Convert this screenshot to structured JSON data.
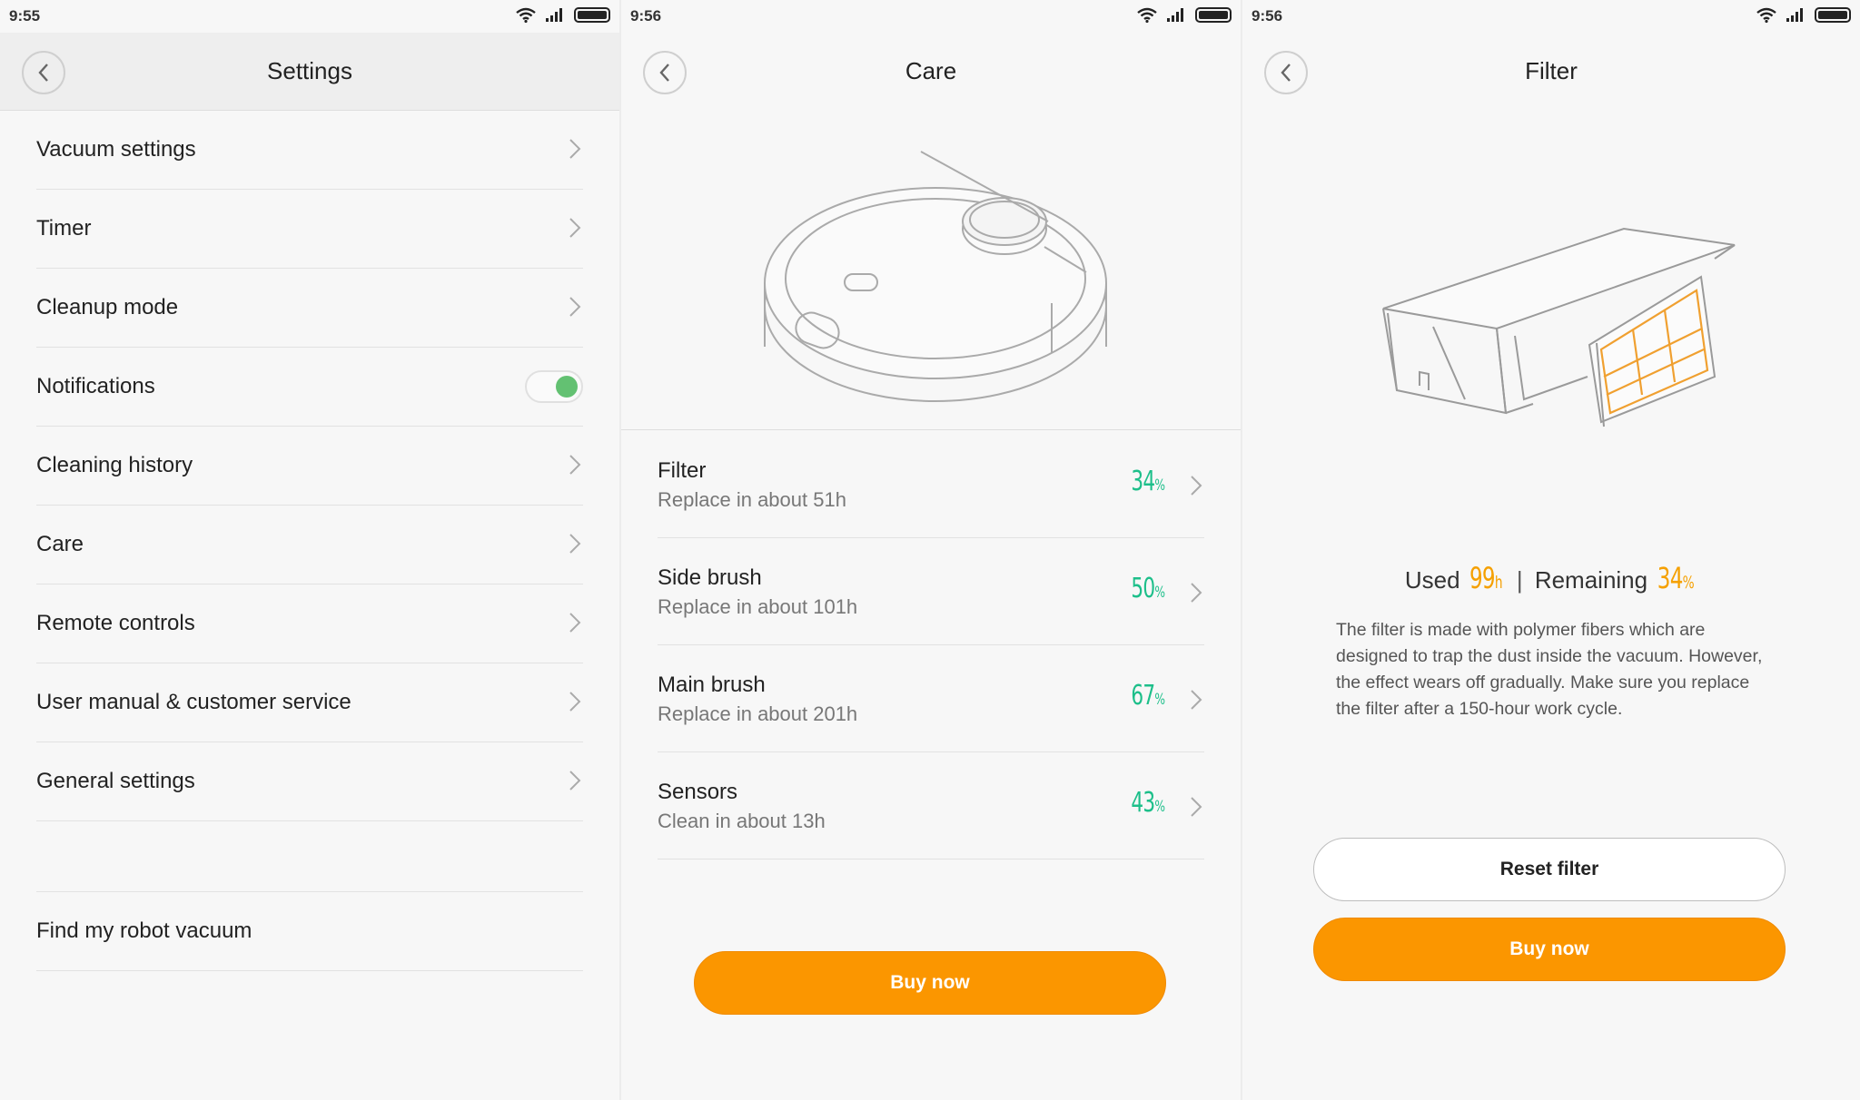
{
  "panels": {
    "settings": {
      "status_time": "9:55",
      "title": "Settings",
      "items": [
        {
          "label": "Vacuum settings"
        },
        {
          "label": "Timer"
        },
        {
          "label": "Cleanup mode"
        },
        {
          "label": "Notifications",
          "toggle": true,
          "toggle_on": true
        },
        {
          "label": "Cleaning history"
        },
        {
          "label": "Care"
        },
        {
          "label": "Remote controls"
        },
        {
          "label": "User manual & customer service"
        },
        {
          "label": "General settings"
        }
      ],
      "find_label": "Find my robot vacuum"
    },
    "care": {
      "status_time": "9:56",
      "title": "Care",
      "items": [
        {
          "name": "Filter",
          "sub": "Replace in about 51h",
          "pct": "34",
          "unit": "%"
        },
        {
          "name": "Side brush",
          "sub": "Replace in about 101h",
          "pct": "50",
          "unit": "%"
        },
        {
          "name": "Main brush",
          "sub": "Replace in about 201h",
          "pct": "67",
          "unit": "%"
        },
        {
          "name": "Sensors",
          "sub": "Clean in about 13h",
          "pct": "43",
          "unit": "%"
        }
      ],
      "buy_label": "Buy now"
    },
    "filter": {
      "status_time": "9:56",
      "title": "Filter",
      "used_label": "Used",
      "used_value": "99",
      "used_unit": "h",
      "separator": "|",
      "remaining_label": "Remaining",
      "remaining_value": "34",
      "remaining_unit": "%",
      "description": "The filter is made with polymer fibers which are designed to trap the dust inside the vacuum. However, the effect wears off gradually. Make sure you replace the filter after a 150-hour work cycle.",
      "reset_label": "Reset filter",
      "buy_label": "Buy now"
    }
  },
  "colors": {
    "accent_orange": "#fb9600",
    "percent_green": "#1dbf8a",
    "toggle_green": "#63c172",
    "stat_orange": "#f5a000"
  },
  "icons": [
    "back-icon",
    "chevron-right-icon",
    "wifi-icon",
    "signal-icon",
    "battery-icon"
  ]
}
